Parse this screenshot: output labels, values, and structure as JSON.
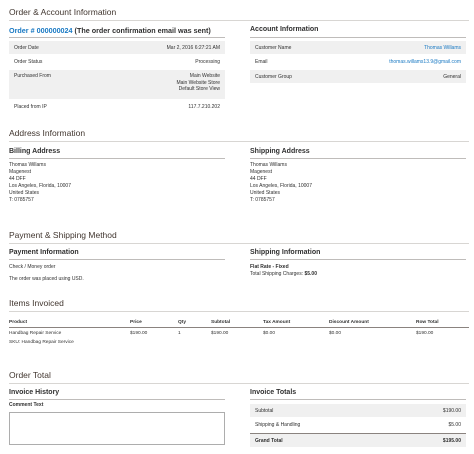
{
  "order_account_section": "Order & Account Information",
  "order": {
    "header_prefix": "Order # ",
    "number": "000000024",
    "header_suffix": " (The order confirmation email was sent)",
    "rows": [
      {
        "label": "Order Date",
        "value": "Mar 2, 2016 6:27:21 AM"
      },
      {
        "label": "Order Status",
        "value": "Processing"
      },
      {
        "label": "Purchased From",
        "value_lines": [
          "Main Website",
          "Main Website Store",
          "Default Store View"
        ]
      },
      {
        "label": "Placed from IP",
        "value": "117.7.210.202"
      }
    ]
  },
  "account": {
    "title": "Account Information",
    "rows": [
      {
        "label": "Customer Name",
        "value": "Thomas Willams"
      },
      {
        "label": "Email",
        "value": "thomas.willams13.9@gmail.com"
      },
      {
        "label": "Customer Group",
        "value": "General"
      }
    ]
  },
  "address_section": "Address Information",
  "billing": {
    "title": "Billing Address",
    "lines": [
      "Thomas Willams",
      "Magenest",
      "44 DFF",
      "Los Angeles, Florida, 10007",
      "United States",
      "T: 0785757"
    ]
  },
  "shipping": {
    "title": "Shipping Address",
    "lines": [
      "Thomas Willams",
      "Magenest",
      "44 DFF",
      "Los Angeles, Florida, 10007",
      "United States",
      "T: 0785757"
    ]
  },
  "payment_shipping_section": "Payment & Shipping Method",
  "payment": {
    "title": "Payment Information",
    "method": "Check / Money order",
    "note": "The order was placed using USD."
  },
  "shipping_info": {
    "title": "Shipping Information",
    "rate": "Flat Rate - Fixed",
    "charges_label": "Total Shipping Charges: ",
    "charges_value": "$5.00"
  },
  "items_section": "Items Invoiced",
  "items": {
    "columns": [
      "Product",
      "Price",
      "Qty",
      "Subtotal",
      "Tax Amount",
      "Discount Amount",
      "Row Total"
    ],
    "rows": [
      {
        "product": "Handbag Repair Service",
        "sku": "SKU: Handbag Repair Service",
        "price": "$190.00",
        "qty": "1",
        "subtotal": "$190.00",
        "tax": "$0.00",
        "discount": "$0.00",
        "row_total": "$190.00"
      }
    ]
  },
  "order_total_section": "Order Total",
  "invoice_history": {
    "title": "Invoice History",
    "comment_label": "Comment Text",
    "comment_value": ""
  },
  "invoice_totals": {
    "title": "Invoice Totals",
    "rows": [
      {
        "label": "Subtotal",
        "value": "$190.00"
      },
      {
        "label": "Shipping & Handling",
        "value": "$5.00"
      },
      {
        "label": "Grand Total",
        "value": "$195.00"
      }
    ]
  }
}
